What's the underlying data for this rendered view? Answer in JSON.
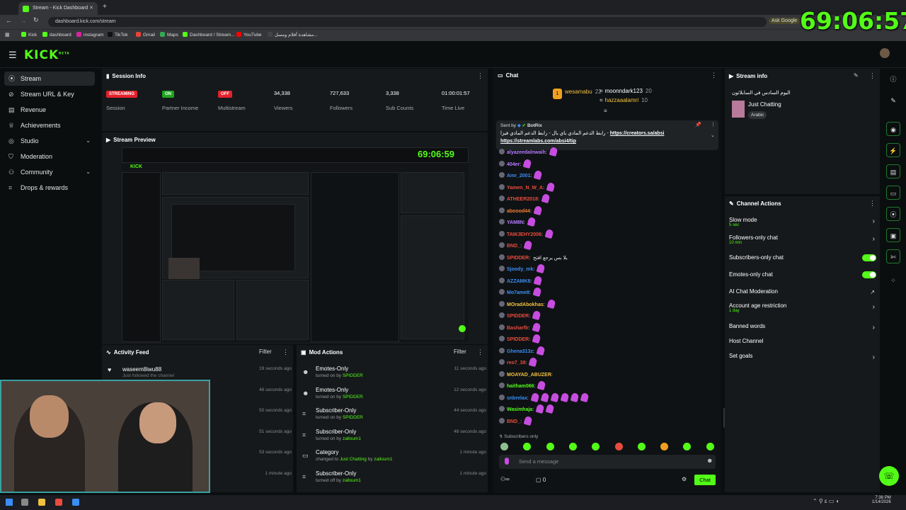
{
  "browser": {
    "tab_title": "Stream - Kick Dashboard",
    "url": "dashboard.kick.com/stream",
    "ask_google": "Ask Google"
  },
  "bookmarks": [
    {
      "label": "Kick",
      "color": "#53fc18"
    },
    {
      "label": "dashboard",
      "color": "#53fc18"
    },
    {
      "label": "instagram",
      "color": "#d6249f"
    },
    {
      "label": "TikTok",
      "color": "#111"
    },
    {
      "label": "Gmail",
      "color": "#ea4335"
    },
    {
      "label": "Maps",
      "color": "#34a853"
    },
    {
      "label": "Dashboard / Stream...",
      "color": "#53fc18"
    },
    {
      "label": "YouTube",
      "color": "#ff0000"
    },
    {
      "label": "مشاهدة أفلام ومسل...",
      "color": "#444"
    }
  ],
  "overlay_timer": "69:06:57",
  "app": {
    "logo": "KICK",
    "logo_sup": "BETA"
  },
  "sidebar": {
    "items": [
      {
        "label": "Stream",
        "icon": "broadcast-icon"
      },
      {
        "label": "Stream URL & Key",
        "icon": "link-icon"
      },
      {
        "label": "Revenue",
        "icon": "revenue-icon"
      },
      {
        "label": "Achievements",
        "icon": "trophy-icon"
      },
      {
        "label": "Studio",
        "icon": "studio-icon"
      },
      {
        "label": "Moderation",
        "icon": "shield-icon"
      },
      {
        "label": "Community",
        "icon": "community-icon"
      },
      {
        "label": "Drops & rewards",
        "icon": "gift-icon"
      }
    ]
  },
  "session": {
    "title": "Session Info",
    "stats": [
      {
        "value": "STREAMING",
        "label": "Session",
        "color": "#e5212c"
      },
      {
        "value": "ON",
        "label": "Partner Income",
        "color": "#1fa51f"
      },
      {
        "value": "OFF",
        "label": "Multistream",
        "color": "#e5212c"
      },
      {
        "value": "34,338",
        "label": "Viewers"
      },
      {
        "value": "727,633",
        "label": "Followers"
      },
      {
        "value": "3,338",
        "label": "Sub Counts"
      },
      {
        "value": "01:00:01:57",
        "label": "Time Live"
      }
    ]
  },
  "preview": {
    "title": "Stream Preview",
    "timer": "69:06:59"
  },
  "activity": {
    "title": "Activity Feed",
    "filter": "Filter",
    "rows": [
      {
        "name": "waseem8iwu88",
        "sub": "Just followed the channel",
        "time": "19 seconds ago"
      },
      {
        "name": "",
        "sub": "",
        "time": "46 seconds ago"
      },
      {
        "name": "",
        "sub": "",
        "time": "50 seconds ago"
      },
      {
        "name": "",
        "sub": "",
        "time": "51 seconds ago"
      },
      {
        "name": "",
        "sub": "",
        "time": "53 seconds ago"
      },
      {
        "name": "",
        "sub": "",
        "time": "1 minute ago"
      }
    ]
  },
  "mod": {
    "title": "Mod Actions",
    "filter": "Filter",
    "rows": [
      {
        "name": "Emotes-Only",
        "pre": "turned on by",
        "by": "SPIDDER",
        "time": "11 seconds ago",
        "icon": "smile-icon"
      },
      {
        "name": "Emotes-Only",
        "pre": "turned on by",
        "by": "SPIDDER",
        "time": "12 seconds ago",
        "icon": "smile-icon"
      },
      {
        "name": "Subscriber-Only",
        "pre": "turned on by",
        "by": "SPIDDER",
        "time": "44 seconds ago",
        "icon": "gift-icon"
      },
      {
        "name": "Subscriber-Only",
        "pre": "turned on by",
        "by": "zalloum1",
        "time": "48 seconds ago",
        "icon": "gift-icon"
      },
      {
        "name": "Category",
        "pre": "changed to",
        "by": "Just Chatting",
        "post": "by",
        "by2": "zalloum1",
        "time": "1 minute ago",
        "icon": "category-icon"
      },
      {
        "name": "Subscriber-Only",
        "pre": "turned off by",
        "by": "zalloum1",
        "time": "1 minute ago",
        "icon": "gift-icon"
      }
    ]
  },
  "chat": {
    "title": "Chat",
    "leaders": [
      {
        "rank": "1",
        "name": "wesamabu",
        "count": "22"
      },
      {
        "rank": "",
        "name": "moonndark123",
        "count": "20"
      },
      {
        "rank": "",
        "name": "hazzaaalamri",
        "count": "10"
      }
    ],
    "pinned": {
      "sent_by": "Sent by",
      "bot": "BotRix",
      "text": "رابط الدعم المادي باي بال - رابط الدعم المادي فيزا -",
      "link1": "https://creators.sa/absi",
      "link2": "https://streamlabs.com/absi4/tip"
    },
    "messages": [
      {
        "user": "alyazeedalnwaih",
        "color": "#b57bff",
        "emotes": 1
      },
      {
        "user": "404er",
        "color": "#b57bff",
        "emotes": 1
      },
      {
        "user": "Amr_2001",
        "color": "#3a8ef6",
        "emotes": 1
      },
      {
        "user": "Yamen_N_W_A",
        "color": "#e84c3d",
        "emotes": 1
      },
      {
        "user": "ATHEER2018",
        "color": "#e84c3d",
        "emotes": 1
      },
      {
        "user": "aboood44",
        "color": "#f0803c",
        "emotes": 1
      },
      {
        "user": "YAM8N",
        "color": "#b57bff",
        "emotes": 1
      },
      {
        "user": "TAWJEHY2006",
        "color": "#e84c3d",
        "emotes": 1
      },
      {
        "user": "BND_",
        "color": "#e84c3d",
        "emotes": 1
      },
      {
        "user": "SPIDDER",
        "color": "#e84c3d",
        "emotes": 0,
        "text": "يلا بس يرجع افتح"
      },
      {
        "user": "Sjoody_mk",
        "color": "#3a8ef6",
        "emotes": 1
      },
      {
        "user": "AZZAMK8",
        "color": "#3a8ef6",
        "emotes": 1
      },
      {
        "user": "Mo7ame8",
        "color": "#3a8ef6",
        "emotes": 1
      },
      {
        "user": "MOradAbokhas",
        "color": "#f0c040",
        "emotes": 1
      },
      {
        "user": "SPIDDER",
        "color": "#e84c3d",
        "emotes": 1
      },
      {
        "user": "Basharflr",
        "color": "#e84c3d",
        "emotes": 1
      },
      {
        "user": "SPIDDER",
        "color": "#e84c3d",
        "emotes": 1
      },
      {
        "user": "Ghena313z",
        "color": "#3a8ef6",
        "emotes": 1
      },
      {
        "user": "reo7_38",
        "color": "#e84c3d",
        "emotes": 1
      },
      {
        "user": "MOAYAD_ABUZER",
        "color": "#f0c040",
        "emotes": 0
      },
      {
        "user": "haitham066",
        "color": "#53fc18",
        "emotes": 1
      },
      {
        "user": "snbrelax",
        "color": "#3a8ef6",
        "emotes": 6
      },
      {
        "user": "Wasimhaja",
        "color": "#53fc18",
        "emotes": 2
      },
      {
        "user": "BND_",
        "color": "#e84c3d",
        "emotes": 1
      }
    ],
    "subscribers_only": "Subscribers only",
    "input_placeholder": "Send a message",
    "send": "Chat",
    "viewers_icon_count": "0"
  },
  "stream_info": {
    "title": "Stream info",
    "stream_title": "اليوم السادس في السابلاثون",
    "category": "Just Chatting",
    "tag": "Arabic"
  },
  "channel_actions": {
    "title": "Channel Actions",
    "rows": [
      {
        "label": "Slow mode",
        "sub": "5 sec",
        "kind": "arrow"
      },
      {
        "label": "Followers-only chat",
        "sub": "10 min",
        "kind": "arrow"
      },
      {
        "label": "Subscribers-only chat",
        "sub": "",
        "kind": "toggle"
      },
      {
        "label": "Emotes-only chat",
        "sub": "",
        "kind": "toggle"
      },
      {
        "label": "AI Chat Moderation",
        "sub": "",
        "kind": "external"
      },
      {
        "label": "Account age restriction",
        "sub": "1 day",
        "kind": "arrow"
      },
      {
        "label": "Banned words",
        "sub": "",
        "kind": "arrow"
      },
      {
        "label": "Host Channel",
        "sub": "",
        "kind": "none"
      },
      {
        "label": "Set goals",
        "sub": "",
        "kind": "arrow"
      }
    ]
  },
  "taskbar": {
    "time": "7:38 PM",
    "date": "1/14/2026"
  },
  "colors": {
    "accent": "#53fc18",
    "panel": "#16191b",
    "bg": "#0b0e0f"
  }
}
